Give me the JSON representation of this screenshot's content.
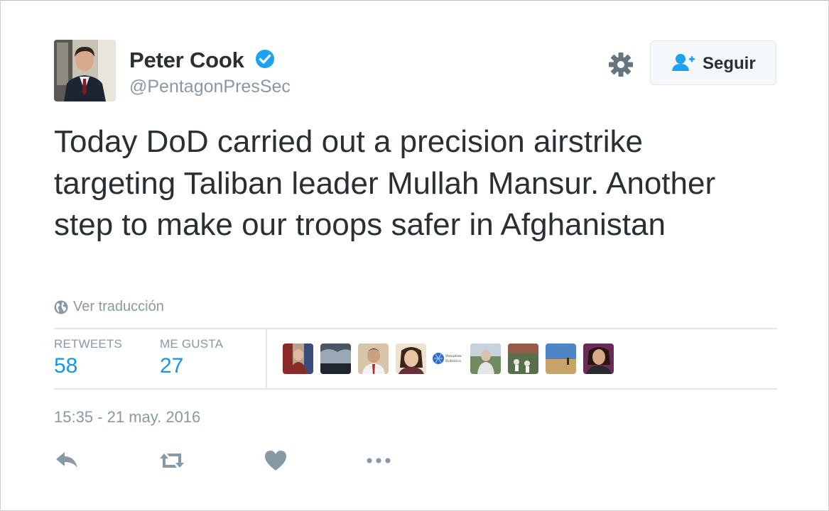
{
  "author": {
    "name": "Peter Cook",
    "handle": "@PentagonPresSec",
    "verified": true
  },
  "follow_button": {
    "label": "Seguir",
    "icon": "add-user-icon"
  },
  "tweet": {
    "text": "Today DoD carried out a precision airstrike targeting Taliban leader Mullah Mansur. Another step to make our troops safer in Afghanistan",
    "translate_label": "Ver traducción",
    "timestamp": "15:35 - 21 may. 2016"
  },
  "stats": {
    "retweets_label": "RETWEETS",
    "retweets_value": "58",
    "likes_label": "ME GUSTA",
    "likes_value": "27"
  },
  "likers": [
    {
      "name": "liker-1"
    },
    {
      "name": "liker-2"
    },
    {
      "name": "liker-3"
    },
    {
      "name": "liker-4"
    },
    {
      "name": "liker-5",
      "logo_text": "Penultimate Robotics"
    },
    {
      "name": "liker-6"
    },
    {
      "name": "liker-7"
    },
    {
      "name": "liker-8"
    },
    {
      "name": "liker-9"
    }
  ],
  "actions": [
    "reply-icon",
    "retweet-icon",
    "like-heart-icon",
    "more-dots-icon"
  ],
  "colors": {
    "text": "#292f33",
    "muted": "#8899a6",
    "accent": "#1b95e0",
    "verified": "#1da1f2",
    "divider": "#e1e8ed"
  }
}
